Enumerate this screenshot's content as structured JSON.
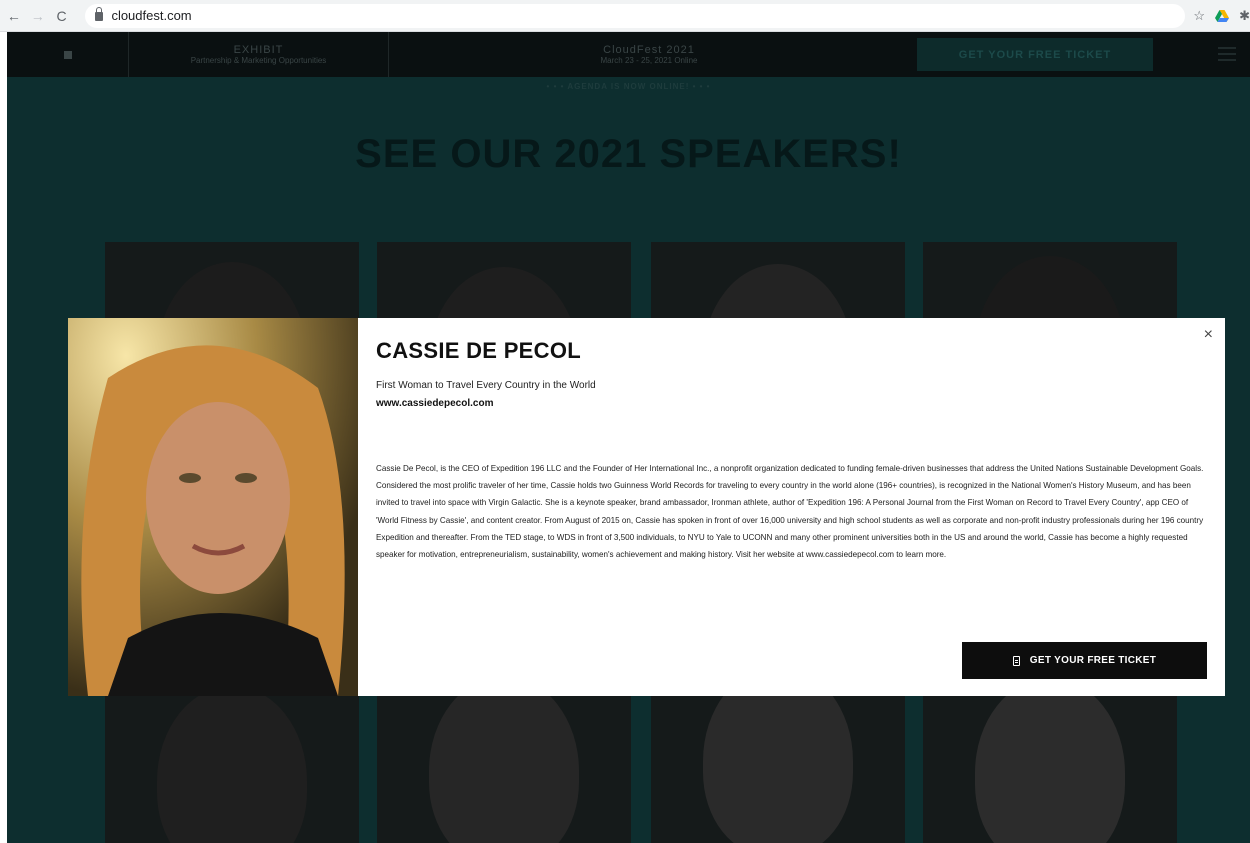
{
  "browser": {
    "url": "cloudfest.com"
  },
  "site_nav": {
    "exhibit_title": "EXHIBIT",
    "exhibit_subtitle": "Partnership & Marketing Opportunities",
    "event_title": "CloudFest 2021",
    "event_dates": "March 23 - 25, 2021 Online",
    "ticket_label": "GET YOUR FREE TICKET"
  },
  "banner": {
    "agenda_text": "• • • AGENDA IS NOW ONLINE! • • •"
  },
  "main": {
    "heading": "SEE OUR 2021 SPEAKERS!"
  },
  "modal": {
    "speaker_name": "CASSIE DE PECOL",
    "speaker_title": "First Woman to Travel Every Country in the World",
    "speaker_website": "www.cassiedepecol.com",
    "bio": "Cassie De Pecol, is the CEO of Expedition 196 LLC and the Founder of Her International Inc., a nonprofit organization dedicated to funding female-driven businesses that address the United Nations Sustainable Development Goals. Considered the most prolific traveler of her time, Cassie holds two Guinness World Records for traveling to every country in the world alone (196+ countries), is recognized in the National Women's History Museum, and has been invited to travel into space with Virgin Galactic. She is a keynote speaker, brand ambassador, Ironman athlete, author of 'Expedition 196: A Personal Journal from the First Woman on Record to Travel Every Country', app CEO of 'World Fitness by Cassie', and content creator. From August of 2015 on, Cassie has spoken in front of over 16,000 university and high school students as well as corporate and non-profit industry professionals during her 196 country Expedition and thereafter. From the TED stage, to WDS in front of 3,500 individuals, to NYU to Yale to UCONN and many other prominent universities both in the US and around the world, Cassie has become a highly requested speaker for motivation, entrepreneurialism, sustainability, women's achievement and making history. Visit her website at www.cassiedepecol.com to learn more.",
    "close_symbol": "×",
    "ticket_button_label": "GET YOUR FREE TICKET"
  },
  "colors": {
    "overlay_bg": "#0d2e2f",
    "button_bg": "#0d0d0d"
  }
}
